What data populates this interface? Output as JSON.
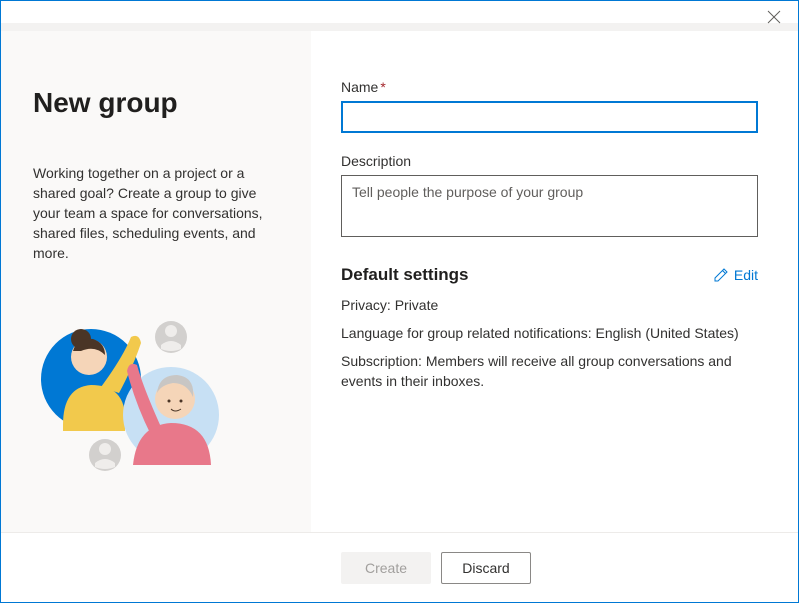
{
  "left": {
    "title": "New group",
    "description": "Working together on a project or a shared goal? Create a group to give your team a space for conversations, shared files, scheduling events, and more."
  },
  "form": {
    "name_label": "Name",
    "name_value": "",
    "description_label": "Description",
    "description_placeholder": "Tell people the purpose of your group",
    "description_value": ""
  },
  "settings": {
    "title": "Default settings",
    "edit_label": "Edit",
    "privacy_key": "Privacy:",
    "privacy_value": "Private",
    "language_key": "Language for group related notifications:",
    "language_value": "English (United States)",
    "subscription_key": "Subscription:",
    "subscription_value": "Members will receive all group conversations and events in their inboxes."
  },
  "footer": {
    "create_label": "Create",
    "discard_label": "Discard"
  },
  "colors": {
    "accent": "#0078d4"
  }
}
